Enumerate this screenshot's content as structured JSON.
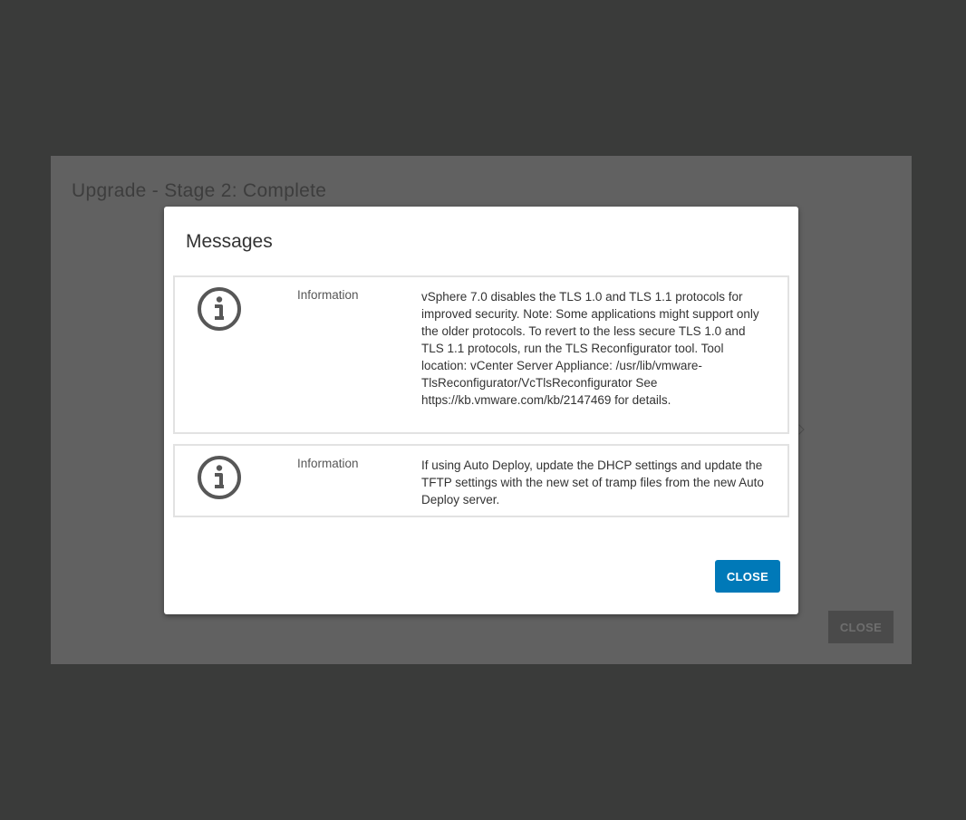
{
  "background_window": {
    "title": "Upgrade - Stage 2: Complete",
    "close_label": "CLOSE"
  },
  "modal": {
    "title": "Messages",
    "messages": [
      {
        "icon": "info-icon",
        "type": "Information",
        "text": "vSphere 7.0 disables the TLS 1.0 and TLS 1.1 protocols for improved security. Note: Some applications might support only the older protocols. To revert to the less secure TLS 1.0 and TLS 1.1 protocols, run the TLS Reconfigurator tool. Tool location: vCenter Server Appliance: /usr/lib/vmware-TlsReconfigurator/VcTlsReconfigurator See https://kb.vmware.com/kb/2147469 for details."
      },
      {
        "icon": "info-icon",
        "type": "Information",
        "text": "If using Auto Deploy, update the DHCP settings and update the TFTP settings with the new set of tramp files from the new Auto Deploy server."
      }
    ],
    "close_label": "CLOSE"
  },
  "colors": {
    "backdrop": "#3a3b3a",
    "primary_button": "#0079b8",
    "icon": "#575757"
  }
}
